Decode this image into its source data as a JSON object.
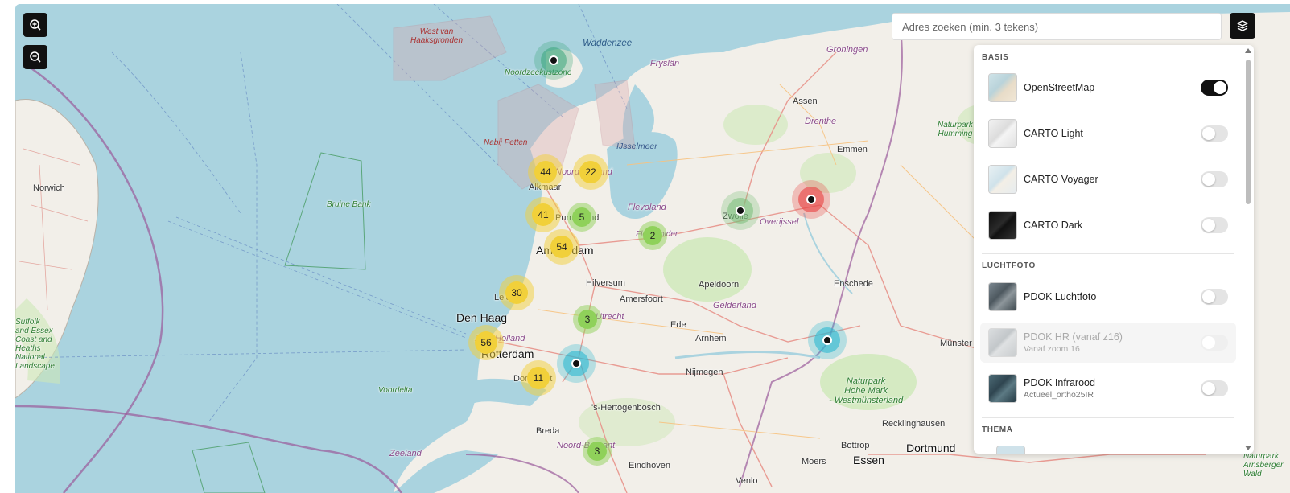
{
  "controls": {
    "zoom_in_icon": "zoom-in-icon",
    "zoom_out_icon": "zoom-out-icon",
    "layers_icon": "layers-icon"
  },
  "search": {
    "placeholder": "Adres zoeken (min. 3 tekens)",
    "value": ""
  },
  "layer_panel": {
    "sections": [
      {
        "title": "BASIS",
        "layers": [
          {
            "name": "OpenStreetMap",
            "sub": "",
            "enabled": true,
            "disabled": false,
            "thumb": "#b9d3da"
          },
          {
            "name": "CARTO Light",
            "sub": "",
            "enabled": false,
            "disabled": false,
            "thumb": "#e6e6e6"
          },
          {
            "name": "CARTO Voyager",
            "sub": "",
            "enabled": false,
            "disabled": false,
            "thumb": "#dbe9ef"
          },
          {
            "name": "CARTO Dark",
            "sub": "",
            "enabled": false,
            "disabled": false,
            "thumb": "#1a1a1a"
          }
        ]
      },
      {
        "title": "LUCHTFOTO",
        "layers": [
          {
            "name": "PDOK Luchtfoto",
            "sub": "",
            "enabled": false,
            "disabled": false,
            "thumb": "#5a6670"
          },
          {
            "name": "PDOK HR (vanaf z16)",
            "sub": "Vanaf zoom 16",
            "enabled": false,
            "disabled": true,
            "thumb": "#bfc4c8"
          },
          {
            "name": "PDOK Infrarood",
            "sub": "Actueel_ortho25IR",
            "enabled": false,
            "disabled": false,
            "thumb": "#3b5560"
          }
        ]
      },
      {
        "title": "THEMA",
        "layers": []
      }
    ]
  },
  "clusters": [
    {
      "count": "44",
      "color": "yellow",
      "x": 0,
      "y": 0
    },
    {
      "count": "22",
      "color": "yellow"
    },
    {
      "count": "41",
      "color": "yellow"
    },
    {
      "count": "5",
      "color": "green"
    },
    {
      "count": "54",
      "color": "yellow"
    },
    {
      "count": "2",
      "color": "green"
    },
    {
      "count": "30",
      "color": "yellow"
    },
    {
      "count": "3",
      "color": "green"
    },
    {
      "count": "56",
      "color": "yellow"
    },
    {
      "count": "11",
      "color": "yellow"
    },
    {
      "count": "3",
      "color": "green"
    }
  ],
  "markers": [
    {
      "color": "teal"
    },
    {
      "color": "green"
    },
    {
      "color": "red"
    },
    {
      "color": "cyan"
    },
    {
      "color": "cyan"
    }
  ],
  "place_labels": {
    "west_van": "West van",
    "hake": "Haaksgronden",
    "waddenzee": "Waddenzee",
    "noordzeekustzone": "Noordzeekustzone",
    "fryslan": "Fryslân",
    "groningen": "Groningen",
    "assen": "Assen",
    "drenthe": "Drenthe",
    "emmen": "Emmen",
    "nabij_petten": "Nabij Petten",
    "ijsselmeer": "IJsselmeer",
    "alkmaar": "Alkmaar",
    "noord_holland": "Noord-Holland",
    "purmerend": "Purmerend",
    "flevoland": "Flevoland",
    "flevopolder": "Flevopolder",
    "zwolle": "Zwolle",
    "overijssel": "Overijssel",
    "amsterdam": "Amsterdam",
    "hilversum": "Hilversum",
    "apeldoorn": "Apeldoorn",
    "enschede": "Enschede",
    "den_haag": "Den Haag",
    "leiden": "Leiden",
    "amersfoort": "Amersfoort",
    "gelderland": "Gelderland",
    "utrecht": "Utrecht",
    "ede": "Ede",
    "arnhem": "Arnhem",
    "zuid_holland": "Zuid-Holland",
    "rotterdam": "Rotterdam",
    "dordrecht": "Dordrecht",
    "nijmegen": "Nijmegen",
    "voordelta": "Voordelta",
    "s_hertogenbosch": "'s-Hertogenbosch",
    "breda": "Breda",
    "noord_brabant": "Noord-Brabant",
    "eindhoven": "Eindhoven",
    "zeeland": "Zeeland",
    "norwich": "Norwich",
    "bruine_bank": "Bruine\nBank",
    "suffolk": "Suffolk\nand Essex\nCoast and\nHeaths\nNational\nLandscape",
    "hohe_mark": "Naturpark\nHohe Mark\n- Westmünsterland",
    "humming": "Naturpark\nHumming",
    "munster": "Münster",
    "recklinghausen": "Recklinghausen",
    "bottrop": "Bottrop",
    "dortmund": "Dortmund",
    "moers": "Moers",
    "essen": "Essen",
    "venlo": "Venlo",
    "arnsberger": "Naturpark\nArnsberger\nWald"
  },
  "colors": {
    "sea": "#aad3df",
    "land": "#f2efe9",
    "green_area": "#cde8b8",
    "cluster_yellow": "#f1d03a",
    "cluster_green": "#8fd15a",
    "marker_teal": "#3aa57a",
    "marker_red": "#e84a4a",
    "marker_cyan": "#2bb7d1"
  }
}
